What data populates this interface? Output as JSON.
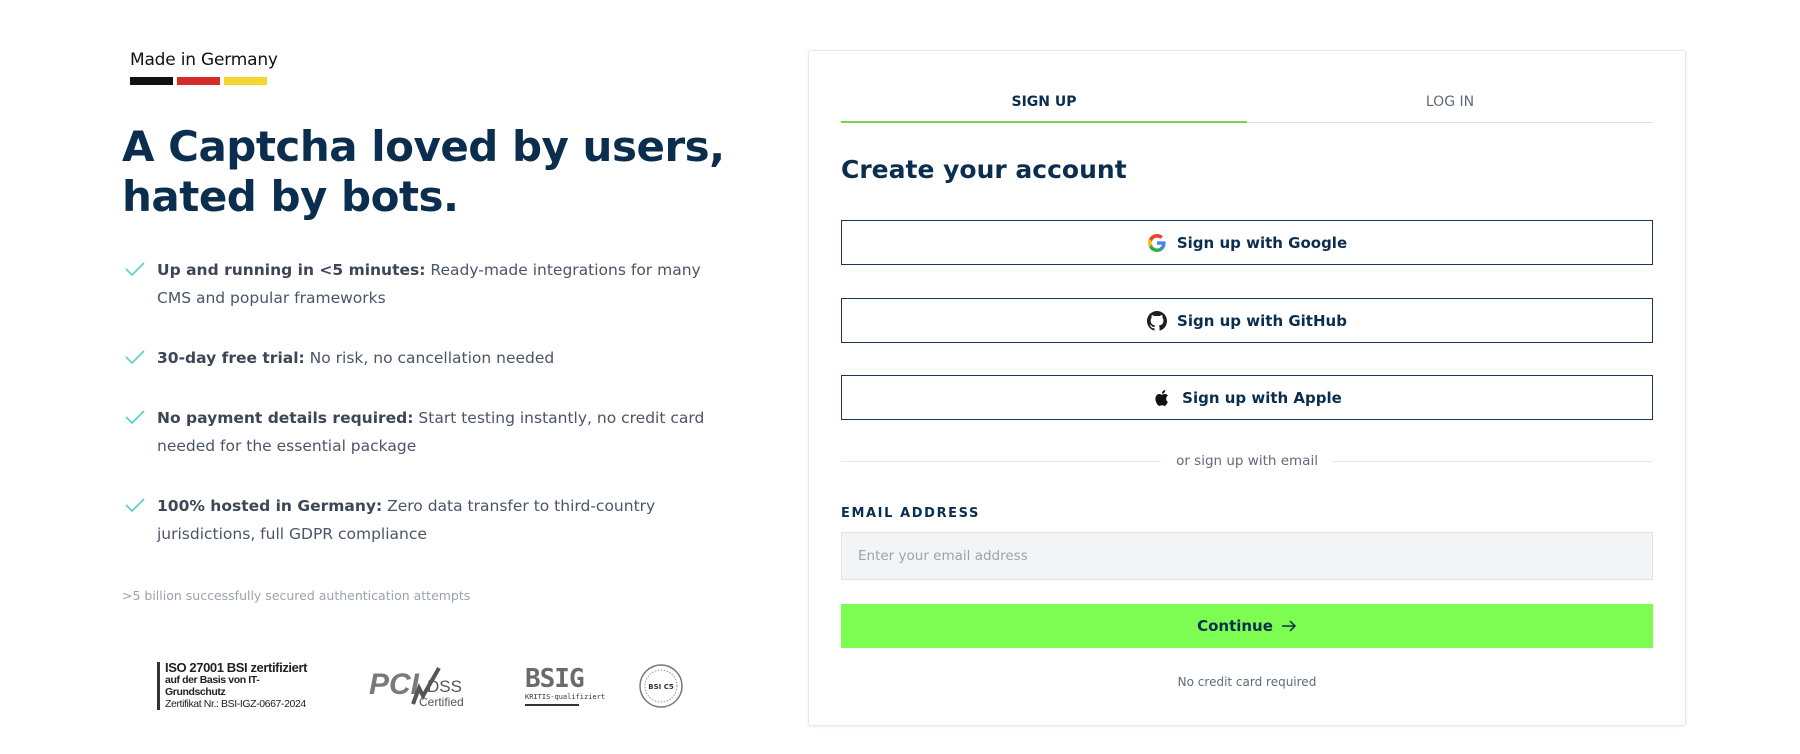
{
  "brand": {
    "made_in": "Made in Germany",
    "flag_colors": [
      "#111111",
      "#d52b2b",
      "#f5d731"
    ]
  },
  "hero": {
    "headline": "A Captcha loved by users, hated by bots."
  },
  "features": [
    {
      "bold": "Up and running in <5 minutes:",
      "text": " Ready-made integrations for many CMS and popular frameworks"
    },
    {
      "bold": "30-day free trial:",
      "text": " No risk, no cancellation needed"
    },
    {
      "bold": "No payment details required:",
      "text": " Start testing instantly, no credit card needed for the essential package"
    },
    {
      "bold": "100% hosted in Germany:",
      "text": " Zero data transfer to third-country jurisdictions, full GDPR compliance"
    }
  ],
  "stat": ">5 billion successfully secured authentication attempts",
  "badges": {
    "iso": {
      "line1": "ISO 27001 BSI zertifiziert",
      "line2": "auf der Basis von IT-Grundschutz",
      "line3": "Zertifikat Nr.: BSI-IGZ-0667-2024"
    },
    "pci": {
      "brand": "PCI",
      "dss": "DSS",
      "certified": "Certified"
    },
    "bsig": {
      "big": "BSIG",
      "small": "KRITIS-qualifiziert"
    },
    "seal": {
      "text": "BSI C5"
    }
  },
  "auth": {
    "tabs": [
      {
        "label": "SIGN UP",
        "active": true
      },
      {
        "label": "LOG IN",
        "active": false
      }
    ],
    "title": "Create your account",
    "google_label": "Sign up with Google",
    "github_label": "Sign up with GitHub",
    "apple_label": "Sign up with Apple",
    "divider": "or sign up with email",
    "email_label": "EMAIL ADDRESS",
    "email_placeholder": "Enter your email address",
    "email_value": "",
    "continue_label": "Continue",
    "footnote": "No credit card required"
  },
  "colors": {
    "accent": "#7dfc52",
    "navy": "#0b2e4f",
    "check": "#4fd3c4"
  }
}
